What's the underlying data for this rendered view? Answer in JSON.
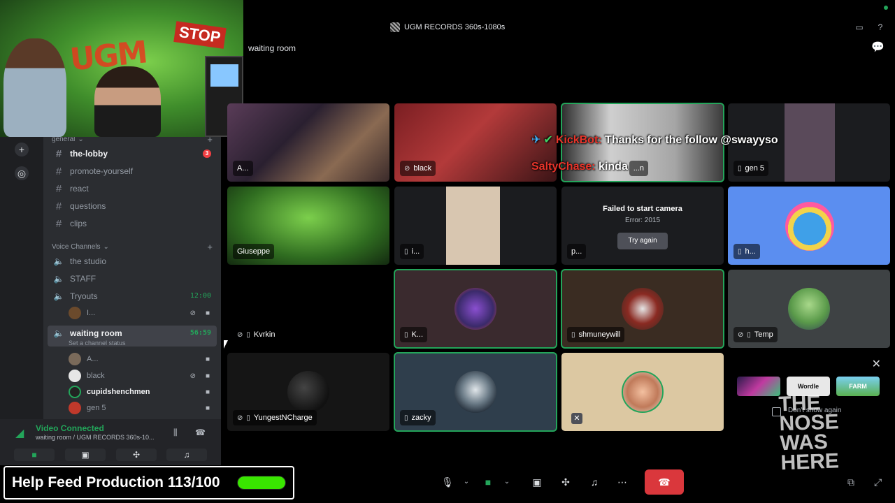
{
  "topbar": {
    "server_title": "UGM RECORDS 360s-1080s",
    "channel_name": "waiting room"
  },
  "webcam": {
    "graffiti": "UGM",
    "sign": "STOP"
  },
  "sidebar": {
    "category_general": "general",
    "text_channels": [
      {
        "name": "the-lobby",
        "badge": "3",
        "unread": true
      },
      {
        "name": "promote-yourself"
      },
      {
        "name": "react"
      },
      {
        "name": "questions"
      },
      {
        "name": "clips"
      }
    ],
    "category_voice": "Voice Channels",
    "voice_channels": {
      "studio": "the studio",
      "staff": "STAFF",
      "tryouts": "Tryouts",
      "tryouts_timer": "12:00",
      "tryouts_user": "I...",
      "waiting": "waiting room",
      "waiting_timer": "56:59",
      "waiting_status": "Set a channel status",
      "waiting_users": [
        "A...",
        "black",
        "cupidshenchmen",
        "gen 5"
      ]
    }
  },
  "voice_panel": {
    "connected": "Video Connected",
    "location": "waiting room / UGM RECORDS 360s-10..."
  },
  "overlay": {
    "feed_text": "Help Feed Production 113/100",
    "feed_progress": 1.0
  },
  "tiles": {
    "t1": "A...",
    "t2": "black",
    "t3": "...n",
    "t4": "gen 5",
    "t5": "Giuseppe",
    "t6": "i...",
    "t7": "p...",
    "t8": "h...",
    "t9": "Kvrkin",
    "t10": "K...",
    "t11": "shmuneywill",
    "t12": "Temp",
    "t13": "YungestNCharge",
    "t14": "zacky"
  },
  "failed_camera": {
    "title": "Failed to start camera",
    "error": "Error: 2015",
    "retry": "Try again"
  },
  "chat": {
    "user1": "KickBot:",
    "msg1": "Thanks for the follow @swayyso",
    "user2": "SaltyChase:",
    "msg2": "kinda"
  },
  "popup": {
    "games": [
      "",
      "Wordle",
      "FARM"
    ],
    "dont_show": "Don't show again",
    "ghost_text": "THE NOSE WAS HERE"
  },
  "colors": {
    "accent_green": "#23a55a",
    "danger": "#da373c",
    "progress_fill": "#39e600"
  }
}
